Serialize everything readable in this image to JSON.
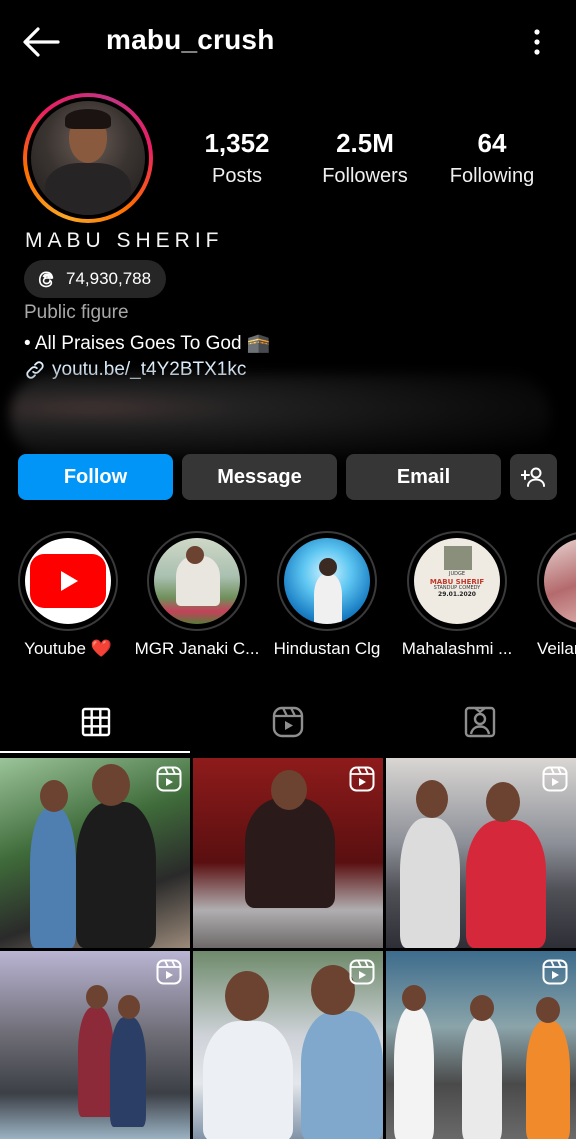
{
  "header": {
    "username": "mabu_crush",
    "back_icon": "arrow-left-icon",
    "more_icon": "more-vertical-icon"
  },
  "profile": {
    "stats": {
      "posts_value": "1,352",
      "posts_label": "Posts",
      "followers_value": "2.5M",
      "followers_label": "Followers",
      "following_value": "64",
      "following_label": "Following"
    },
    "full_name": "MABU SHERIF",
    "threads_count": "74,930,788",
    "category": "Public figure",
    "bio": "• All Praises Goes To God 🕋",
    "link": "youtu.be/_t4Y2BTX1kc"
  },
  "actions": {
    "follow": "Follow",
    "message": "Message",
    "email": "Email"
  },
  "highlights": [
    {
      "label": "Youtube ❤️"
    },
    {
      "label": "MGR Janaki C..."
    },
    {
      "label": "Hindustan Clg"
    },
    {
      "label": "Mahalashmi ..."
    },
    {
      "label": "Veilank"
    }
  ],
  "highlight_4_poster": {
    "line1": "JUDGE",
    "line2": "MABU SHERIF",
    "line3": "STANDUP COMEDY",
    "line4": "29.01.2020"
  },
  "tabs": [
    {
      "icon": "grid-icon"
    },
    {
      "icon": "reels-icon"
    },
    {
      "icon": "tagged-icon"
    }
  ],
  "colors": {
    "follow_button": "#0095f6",
    "secondary_button": "#363636",
    "background": "#000000"
  }
}
